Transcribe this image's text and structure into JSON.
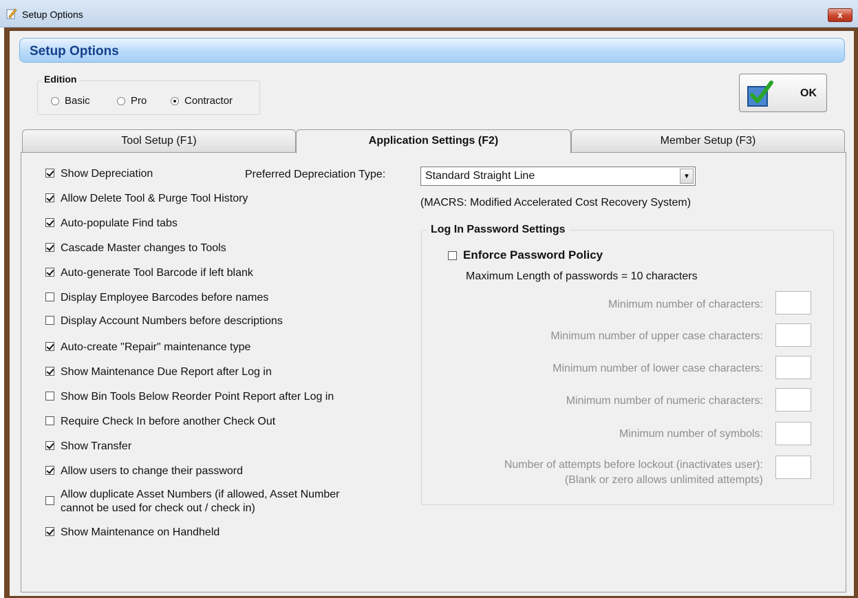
{
  "window": {
    "title": "Setup Options",
    "close_label": "x"
  },
  "header": {
    "title": "Setup Options"
  },
  "edition": {
    "legend": "Edition",
    "options": [
      {
        "label": "Basic",
        "selected": false
      },
      {
        "label": "Pro",
        "selected": false
      },
      {
        "label": "Contractor",
        "selected": true
      }
    ]
  },
  "ok_button": {
    "label": "OK"
  },
  "tabs": [
    {
      "label": "Tool Setup (F1)",
      "active": false
    },
    {
      "label": "Application Settings (F2)",
      "active": true
    },
    {
      "label": "Member Setup (F3)",
      "active": false
    }
  ],
  "settings": [
    {
      "label": "Show Depreciation",
      "checked": true
    },
    {
      "label": "Allow Delete Tool & Purge Tool History",
      "checked": true
    },
    {
      "label": "Auto-populate Find tabs",
      "checked": true
    },
    {
      "label": "Cascade Master changes to Tools",
      "checked": true
    },
    {
      "label": "Auto-generate Tool Barcode if left blank",
      "checked": true
    },
    {
      "label": "Display Employee Barcodes before names",
      "checked": false
    },
    {
      "label": "Display Account Numbers before descriptions",
      "checked": false
    },
    {
      "label": "Auto-create \"Repair\" maintenance type",
      "checked": true
    },
    {
      "label": "Show Maintenance Due Report after Log in",
      "checked": true
    },
    {
      "label": "Show Bin Tools Below Reorder Point Report after Log in",
      "checked": false
    },
    {
      "label": "Require Check In before another Check Out",
      "checked": false
    },
    {
      "label": "Show Transfer",
      "checked": true
    },
    {
      "label": "Allow users to change their password",
      "checked": true
    },
    {
      "label": "Allow duplicate Asset Numbers (if allowed, Asset Number",
      "label_line2": "cannot be used for check out / check in)",
      "checked": false
    },
    {
      "label": "Show Maintenance on Handheld",
      "checked": true
    }
  ],
  "depreciation": {
    "label": "Preferred Depreciation Type:",
    "selected": "Standard Straight Line",
    "note": "(MACRS:  Modified Accelerated Cost Recovery System)"
  },
  "password": {
    "legend": "Log In Password Settings",
    "enforce_label": "Enforce Password Policy",
    "enforce_checked": false,
    "max_length_text": "Maximum Length of passwords = 10 characters",
    "rows": [
      {
        "label": "Minimum number of characters:",
        "value": ""
      },
      {
        "label": "Minimum number of upper case characters:",
        "value": ""
      },
      {
        "label": "Minimum number of lower case characters:",
        "value": ""
      },
      {
        "label": "Minimum number of numeric characters:",
        "value": ""
      },
      {
        "label": "Minimum number of symbols:",
        "value": ""
      },
      {
        "label": "Number of attempts before lockout (inactivates user):",
        "label_line2": "(Blank or zero allows unlimited attempts)",
        "value": ""
      }
    ]
  },
  "colors": {
    "frame": "#6e4628",
    "banner_text": "#16408a",
    "disabled_text": "#8e8e8e"
  }
}
